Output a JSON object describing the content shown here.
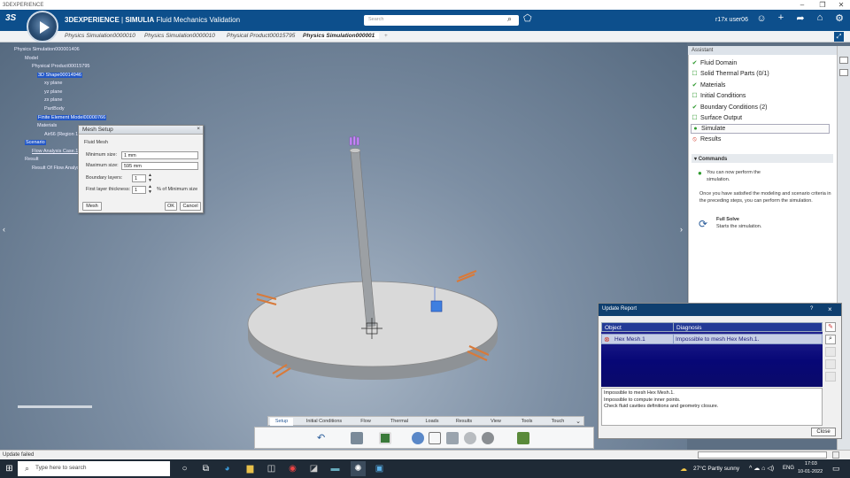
{
  "window": {
    "title": "3DEXPERIENCE"
  },
  "header": {
    "brand": "3DEXPERIENCE | SIMULIA Fluid Mechanics Validation",
    "brand_part1": "3DEXPERIENCE",
    "brand_part2": "SIMULIA",
    "brand_part3": "Fluid Mechanics Validation",
    "search_placeholder": "Search",
    "user": "r17x user06"
  },
  "tabs": [
    "Physics Simulation0000010",
    "Physics Simulation0000010",
    "Physical Product00015795",
    "Physics Simulation000001",
    "+"
  ],
  "tree": {
    "items": [
      "Physics Simulation000001406",
      "Model",
      "Physical Product00015795",
      "3D Shape00014946",
      "xy plane",
      "yz plane",
      "zx plane",
      "PartBody",
      "Finite Element Model00000766",
      "Materials",
      "Air66 (Region 1)",
      "Scenario",
      "Flow Analysis Case.1",
      "Result",
      "Result Of Flow Analysis"
    ]
  },
  "mesh_setup": {
    "title": "Mesh Setup",
    "section": "Fluid Mesh",
    "min_label": "Minimum size:",
    "min_value": "1 mm",
    "max_label": "Maximum size:",
    "max_value": "595 mm",
    "bl_label": "Boundary layers:",
    "bl_value": "1",
    "flt_label": "First layer thickness:",
    "flt_value": "1",
    "flt_unit": "% of Minimum size",
    "mesh_btn": "Mesh",
    "ok_btn": "OK",
    "cancel_btn": "Cancel"
  },
  "assistant": {
    "title": "Assistant",
    "steps": [
      {
        "label": "Fluid Domain",
        "state": "done"
      },
      {
        "label": "Solid Thermal Parts (0/1)",
        "state": "todo"
      },
      {
        "label": "Materials",
        "state": "done"
      },
      {
        "label": "Initial Conditions",
        "state": "todo"
      },
      {
        "label": "Boundary Conditions (2)",
        "state": "done"
      },
      {
        "label": "Surface Output",
        "state": "todo"
      },
      {
        "label": "Simulate",
        "state": "current"
      },
      {
        "label": "Results",
        "state": "blocked"
      }
    ],
    "commands_label": "Commands",
    "msg1": "You can now perform the simulation.",
    "msg2": "Once you have satisfied the modeling and scenario criteria in the preceding steps, you can perform the simulation.",
    "full_solve": "Full Solve",
    "full_solve_desc": "Starts the simulation."
  },
  "update_report": {
    "title": "Update Report",
    "help": "?",
    "col_object": "Object",
    "col_diag": "Diagnosis",
    "row_object": "Hex Mesh.1",
    "row_diag": "Impossible to mesh Hex Mesh.1.",
    "messages": [
      "Impossible to mesh Hex Mesh.1.",
      "Impossible to compute inner points.",
      "Check fluid cavities definitions and geometry closure."
    ],
    "close": "Close"
  },
  "action_tabs": [
    "Setup",
    "Initial Conditions",
    "Flow",
    "Thermal",
    "Loads",
    "Results",
    "View",
    "Tools",
    "Touch"
  ],
  "status": "Update failed",
  "taskbar": {
    "search": "Type here to search",
    "weather": "27°C  Partly sunny",
    "lang": "ENG",
    "time": "17:03",
    "date": "10-01-2022"
  },
  "colors": {
    "header": "#0d4f8c",
    "highlight": "#2257c7",
    "check": "#2f9a2f",
    "error": "#d23a2a",
    "report_bg": "#070776"
  }
}
